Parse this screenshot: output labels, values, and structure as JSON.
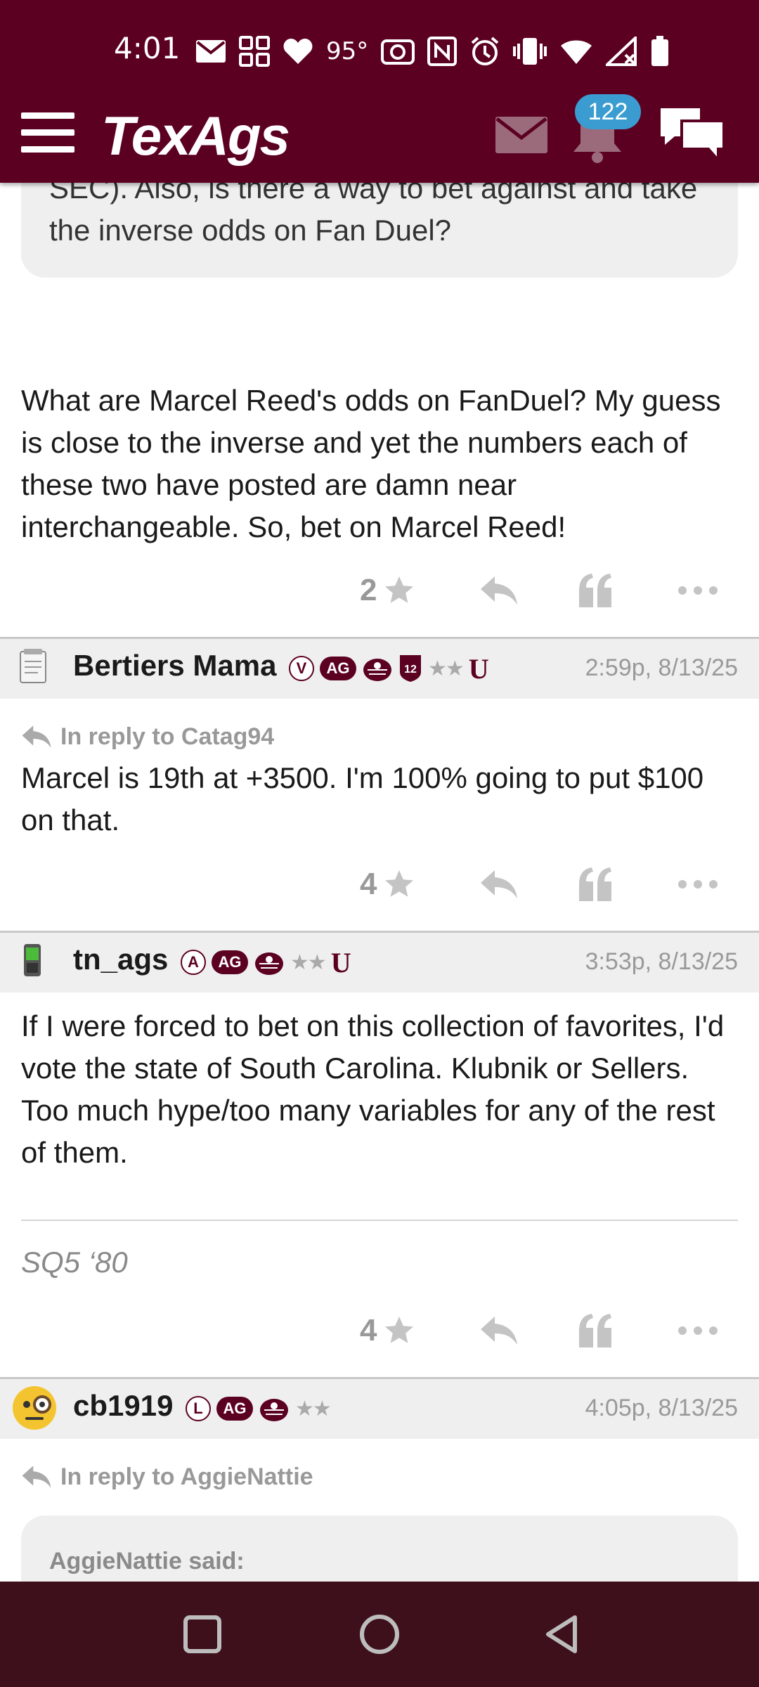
{
  "status_bar": {
    "time": "4:01",
    "temperature": "95°"
  },
  "header": {
    "logo": "TexAgs",
    "notification_count": "122",
    "brand_color": "#5c0022"
  },
  "top_quote": {
    "text": "SEC). Also, is there a way to bet against and take the inverse odds on Fan Duel?"
  },
  "posts": [
    {
      "body": "What are Marcel Reed's odds on FanDuel? My guess is close to the inverse and yet the numbers each of these two have posted are damn near interchangeable. So, bet on Marcel Reed!",
      "stars": "2"
    },
    {
      "author": "Bertiers Mama",
      "badges": [
        "V",
        "AG",
        "12",
        "★★",
        "U"
      ],
      "time": "2:59p, 8/13/25",
      "reply_to": "In reply to Catag94",
      "body": "Marcel is 19th at +3500. I'm 100% going to put $100 on that.",
      "stars": "4"
    },
    {
      "author": "tn_ags",
      "badges": [
        "A",
        "AG",
        "★★",
        "U"
      ],
      "time": "3:53p, 8/13/25",
      "body": "If I were forced to bet on this collection of favorites, I'd vote the state of South Carolina. Klubnik or Sellers. Too much hype/too many variables for any of the rest of them.",
      "signature": "SQ5 ‘80",
      "stars": "4"
    },
    {
      "author": "cb1919",
      "badges": [
        "L",
        "AG",
        "★★"
      ],
      "time": "4:05p, 8/13/25",
      "reply_to": "In reply to AggieNattie",
      "quote_author": "AggieNattie said:"
    }
  ]
}
